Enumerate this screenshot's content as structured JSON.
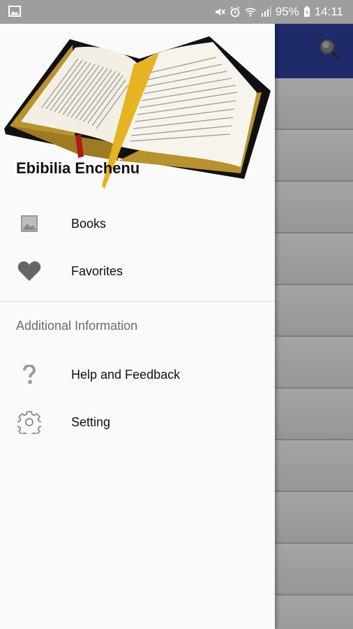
{
  "status_bar": {
    "battery": "95%",
    "time": "14:11"
  },
  "drawer": {
    "app_name": "Ebibilia Enchenu",
    "items": [
      {
        "label": "Books",
        "icon": "image-icon"
      },
      {
        "label": "Favorites",
        "icon": "heart-icon"
      }
    ],
    "section_title": "Additional Information",
    "items2": [
      {
        "label": "Help and Feedback",
        "icon": "help-icon"
      },
      {
        "label": "Setting",
        "icon": "gear-icon"
      }
    ]
  },
  "colors": {
    "toolbar": "#1f2a6a",
    "drawer_bg": "#fafafa",
    "icon_grey": "#757575"
  }
}
